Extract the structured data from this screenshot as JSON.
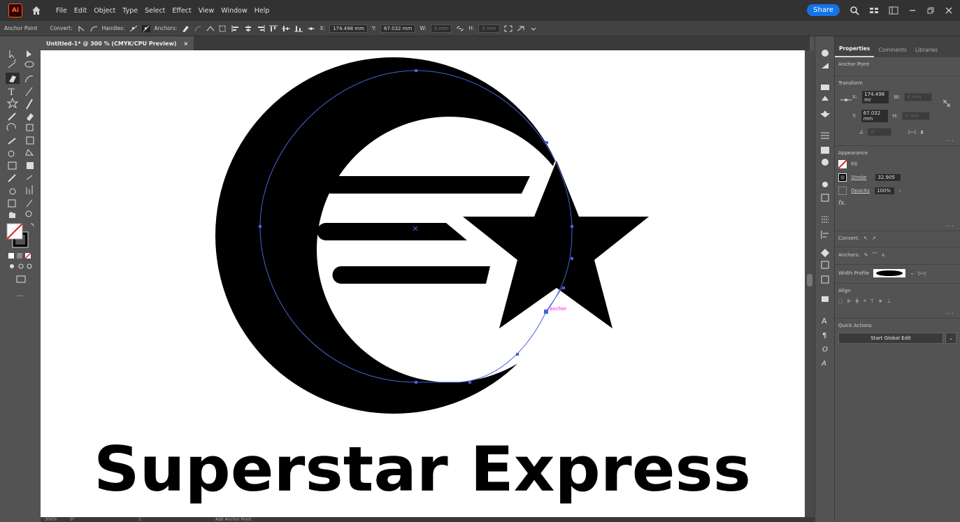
{
  "app": {
    "logo": "Ai",
    "colors": {
      "brand_bg": "#330000",
      "brand_fg": "#ff6a2b",
      "accent": "#1473e6",
      "selection": "#4a62d9",
      "anchor_label": "#ff00ff"
    }
  },
  "menubar": {
    "items": [
      "File",
      "Edit",
      "Object",
      "Type",
      "Select",
      "Effect",
      "View",
      "Window",
      "Help"
    ],
    "share_label": "Share"
  },
  "controlbar": {
    "tool_label": "Anchor Point",
    "convert_label": "Convert:",
    "handles_label": "Handles:",
    "anchors_label": "Anchors:",
    "x_label": "X:",
    "x_value": "174.498 mm",
    "y_label": "Y:",
    "y_value": "67.032 mm",
    "w_label": "W:",
    "w_value": "0 mm",
    "h_label": "H:",
    "h_value": "0 mm"
  },
  "document": {
    "tab_title": "Untitled-1* @ 300 % (CMYK/CPU Preview)",
    "close_glyph": "×",
    "logo_text": "Superstar Express",
    "anchor_hint": "anchor"
  },
  "status": {
    "zoom": "300%",
    "rotation": "0°",
    "artboard": "1",
    "tool": "Add Anchor Point"
  },
  "panel": {
    "tabs": [
      "Properties",
      "Comments",
      "Libraries"
    ],
    "selection_type": "Anchor Point",
    "transform": {
      "title": "Transform",
      "x_label": "X:",
      "x_value": "174.498 mr",
      "y_label": "Y:",
      "y_value": "67.032 mm",
      "w_label": "W:",
      "w_value": "0 mm",
      "h_label": "H:",
      "h_value": "0 mm",
      "angle_value": "0°"
    },
    "appearance": {
      "title": "Appearance",
      "fill_label": "Fill",
      "stroke_label": "Stroke",
      "stroke_value": "32.905",
      "opacity_label": "Opacity",
      "opacity_value": "100%",
      "fx_label": "fx."
    },
    "convert_label": "Convert:",
    "anchors_label": "Anchors:",
    "width_profile_label": "Width Profile",
    "align_title": "Align",
    "quick_actions_title": "Quick Actions",
    "global_edit_label": "Start Global Edit",
    "more_glyph": "..."
  }
}
